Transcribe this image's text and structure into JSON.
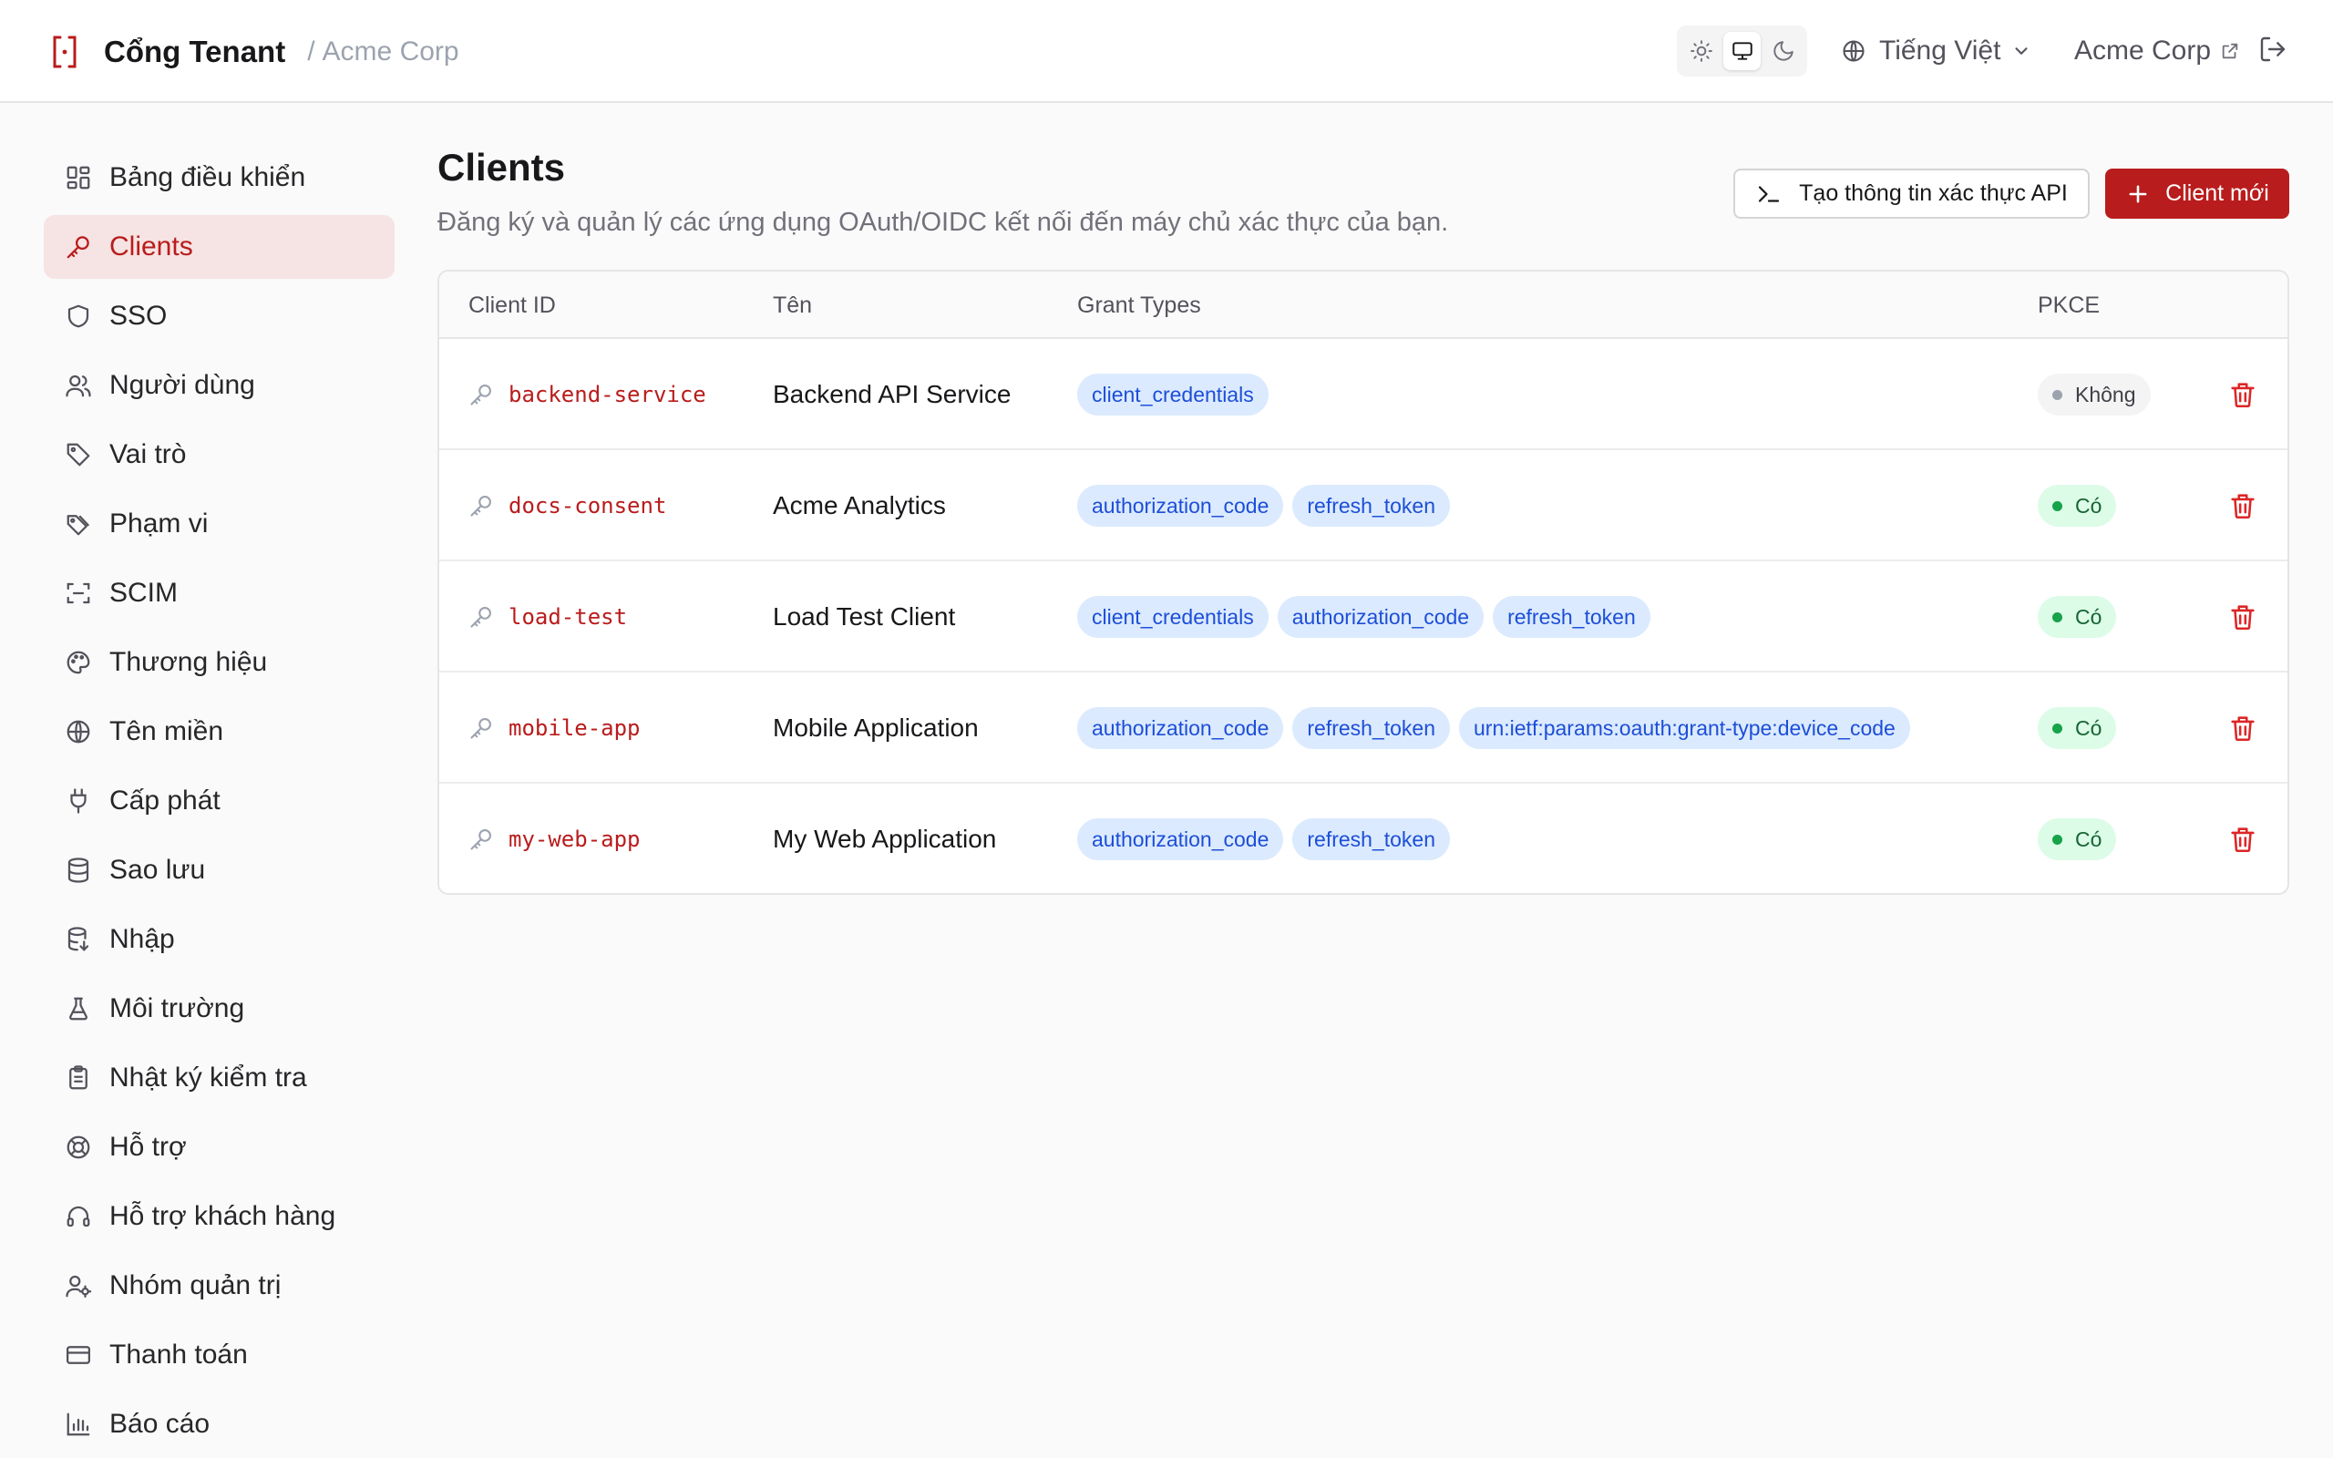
{
  "header": {
    "title": "Cổng Tenant",
    "separator": "/",
    "tenant": "Acme Corp",
    "language": "Tiếng Việt",
    "org_link": "Acme Corp",
    "theme_active": "system"
  },
  "sidebar": {
    "items": [
      {
        "label": "Bảng điều khiển",
        "icon": "dashboard-icon"
      },
      {
        "label": "Clients",
        "icon": "key-icon",
        "active": true
      },
      {
        "label": "SSO",
        "icon": "shield-icon"
      },
      {
        "label": "Người dùng",
        "icon": "users-icon"
      },
      {
        "label": "Vai trò",
        "icon": "tag-icon"
      },
      {
        "label": "Phạm vi",
        "icon": "tags-icon"
      },
      {
        "label": "SCIM",
        "icon": "scan-icon"
      },
      {
        "label": "Thương hiệu",
        "icon": "palette-icon"
      },
      {
        "label": "Tên miền",
        "icon": "globe-icon"
      },
      {
        "label": "Cấp phát",
        "icon": "plug-icon"
      },
      {
        "label": "Sao lưu",
        "icon": "database-icon"
      },
      {
        "label": "Nhập",
        "icon": "database-import-icon"
      },
      {
        "label": "Môi trường",
        "icon": "flask-icon"
      },
      {
        "label": "Nhật ký kiểm tra",
        "icon": "clipboard-icon"
      },
      {
        "label": "Hỗ trợ",
        "icon": "lifebuoy-icon"
      },
      {
        "label": "Hỗ trợ khách hàng",
        "icon": "headset-icon"
      },
      {
        "label": "Nhóm quản trị",
        "icon": "user-cog-icon"
      },
      {
        "label": "Thanh toán",
        "icon": "credit-card-icon"
      },
      {
        "label": "Báo cáo",
        "icon": "bar-chart-icon"
      }
    ]
  },
  "main": {
    "title": "Clients",
    "description": "Đăng ký và quản lý các ứng dụng OAuth/OIDC kết nối đến máy chủ xác thực của bạn.",
    "create_api_credential_label": "Tạo thông tin xác thực API",
    "new_client_label": "Client mới",
    "table": {
      "columns": [
        "Client ID",
        "Tên",
        "Grant Types",
        "PKCE"
      ],
      "rows": [
        {
          "client_id": "backend-service",
          "name": "Backend API Service",
          "grants": [
            "client_credentials"
          ],
          "pkce": "Không",
          "pkce_enabled": false
        },
        {
          "client_id": "docs-consent",
          "name": "Acme Analytics",
          "grants": [
            "authorization_code",
            "refresh_token"
          ],
          "pkce": "Có",
          "pkce_enabled": true
        },
        {
          "client_id": "load-test",
          "name": "Load Test Client",
          "grants": [
            "client_credentials",
            "authorization_code",
            "refresh_token"
          ],
          "pkce": "Có",
          "pkce_enabled": true
        },
        {
          "client_id": "mobile-app",
          "name": "Mobile Application",
          "grants": [
            "authorization_code",
            "refresh_token",
            "urn:ietf:params:oauth:grant-type:device_code"
          ],
          "pkce": "Có",
          "pkce_enabled": true
        },
        {
          "client_id": "my-web-app",
          "name": "My Web Application",
          "grants": [
            "authorization_code",
            "refresh_token"
          ],
          "pkce": "Có",
          "pkce_enabled": true
        }
      ]
    }
  },
  "colors": {
    "accent": "#b91c1c",
    "active_nav_bg": "#f6e3e3",
    "chip_bg": "#dbeafe",
    "chip_text": "#1d4ed8",
    "pkce_yes_bg": "#dcfce7",
    "pkce_yes_dot": "#16a34a"
  }
}
